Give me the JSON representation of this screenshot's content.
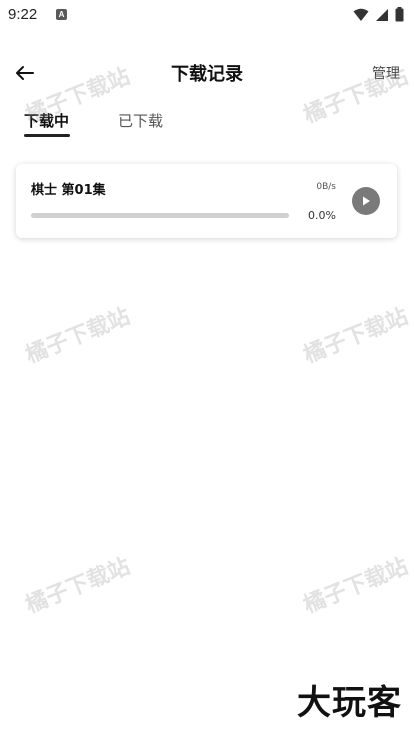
{
  "status_bar": {
    "time": "9:22",
    "notification_icon": "A"
  },
  "header": {
    "title": "下载记录",
    "manage_label": "管理"
  },
  "tabs": [
    {
      "label": "下载中",
      "active": true
    },
    {
      "label": "已下载",
      "active": false
    }
  ],
  "downloads": [
    {
      "title": "棋士 第01集",
      "speed": "0B/s",
      "progress_percent": "0.0%",
      "progress_value": 0.0
    }
  ],
  "watermark_text": "橘子下载站",
  "brand_logo": "大玩客",
  "colors": {
    "accent": "#4a8cf7",
    "play_button": "#7a7a7a",
    "tab_indicator": "#222222"
  }
}
